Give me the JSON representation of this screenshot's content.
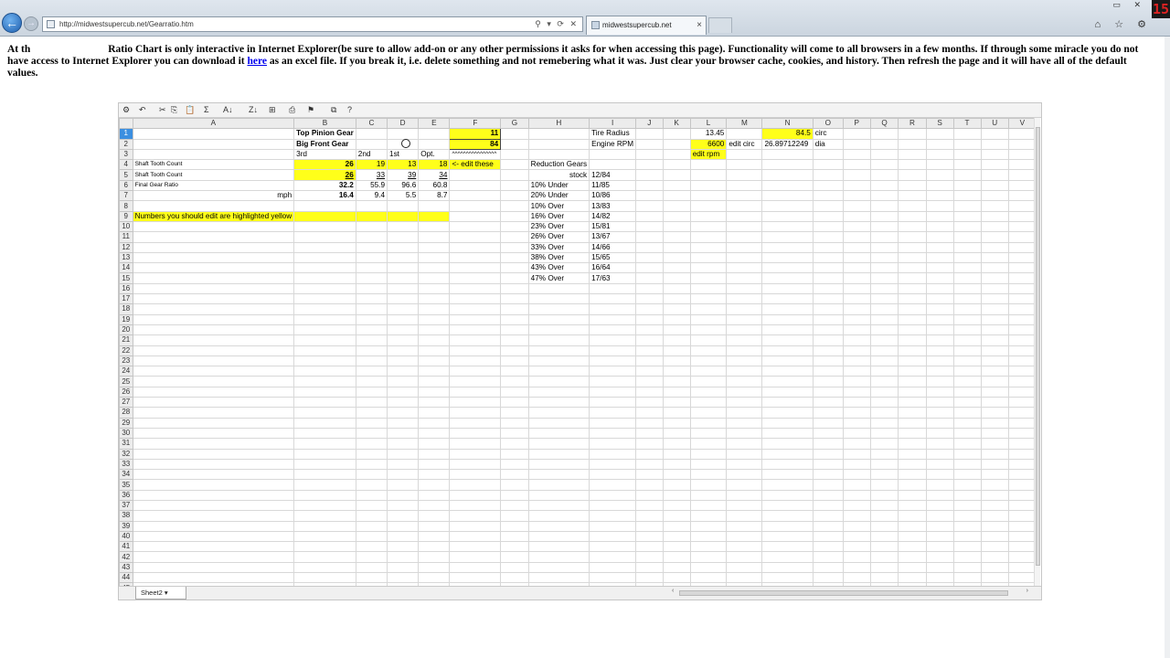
{
  "browser": {
    "url": "http://midwestsupercub.net/Gearratio.htm",
    "tab_title": "midwestsupercub.net",
    "tab_close": "×",
    "addr_tools": "⚲ ▾ ⟳ ✕",
    "window_controls": "▭ ✕",
    "tool_icons": "⌂ ☆ ⚙",
    "recording_badge": "15"
  },
  "intro": {
    "start": "At th",
    "middle": "Ratio Chart is only interactive in Internet Explorer(be sure to allow add-on or any other permissions it asks for when accessing this page). Functionality will come to all browsers in a few months. If through some miracle you do not have access to Internet Explorer you can download it ",
    "link_text": "here",
    "end": " as an excel file. If you break it, i.e. delete something and not remebering what it was. Just clear your browser cache, cookies, and history. Then refresh the page and it will have all of the default values."
  },
  "spreadsheet": {
    "toolbar_icons": [
      "⚙",
      "↶",
      "✂",
      "⎘",
      "📋",
      "Σ",
      "A↓",
      "Z↓",
      "⊞",
      "⎙",
      "⚑",
      "⧉",
      "?"
    ],
    "columns": [
      "A",
      "B",
      "C",
      "D",
      "E",
      "F",
      "G",
      "H",
      "I",
      "J",
      "K",
      "L",
      "M",
      "N",
      "O",
      "P",
      "Q",
      "R",
      "S",
      "T",
      "U",
      "V"
    ],
    "selected_column": "F",
    "selected_row": "1",
    "row_count": 46,
    "cells": {
      "B1": "Top Pinion Gear",
      "F1": "11",
      "I1": "Tire Radius",
      "L1": "13.45",
      "N1": "84.5",
      "O1": "circ",
      "B2": "Big Front Gear",
      "F2": "84",
      "I2": "Engine RPM",
      "L2": "6600",
      "M2": "edit circ",
      "N2": "26.89712249",
      "O2": "dia",
      "B3": "3rd",
      "C3": "2nd",
      "D3": "1st",
      "E3": "Opt.",
      "F3": "^^^^^^^^^^^^^^^^",
      "L3": "edit rpm",
      "A4": "Shaft Tooth Count",
      "B4": "26",
      "C4": "19",
      "D4": "13",
      "E4": "18",
      "F4": "<- edit these",
      "H4": "Reduction Gears",
      "A5": "Shaft Tooth Count",
      "B5": "26",
      "C5": "33",
      "D5": "39",
      "E5": "34",
      "H5": "stock",
      "I5": "12/84",
      "A6": "Final Gear Ratio",
      "B6": "32.2",
      "C6": "55.9",
      "D6": "96.6",
      "E6": "60.8",
      "H6": "10% Under",
      "I6": "11/85",
      "A7": "mph",
      "B7": "16.4",
      "C7": "9.4",
      "D7": "5.5",
      "E7": "8.7",
      "H7": "20% Under",
      "I7": "10/86",
      "H8": "10% Over",
      "I8": "13/83",
      "A9": "Numbers you should edit are highlighted yellow",
      "H9": "16% Over",
      "I9": "14/82",
      "H10": "23% Over",
      "I10": "15/81",
      "H11": "26% Over",
      "I11": "13/67",
      "H12": "33% Over",
      "I12": "14/66",
      "H13": "38% Over",
      "I13": "15/65",
      "H14": "43% Over",
      "I14": "16/64",
      "H15": "47% Over",
      "I15": "17/63"
    },
    "sheet_tab": "Sheet2",
    "sheet_tab_arrow": "▾",
    "hscroll_left": "‹",
    "hscroll_right": "›"
  }
}
